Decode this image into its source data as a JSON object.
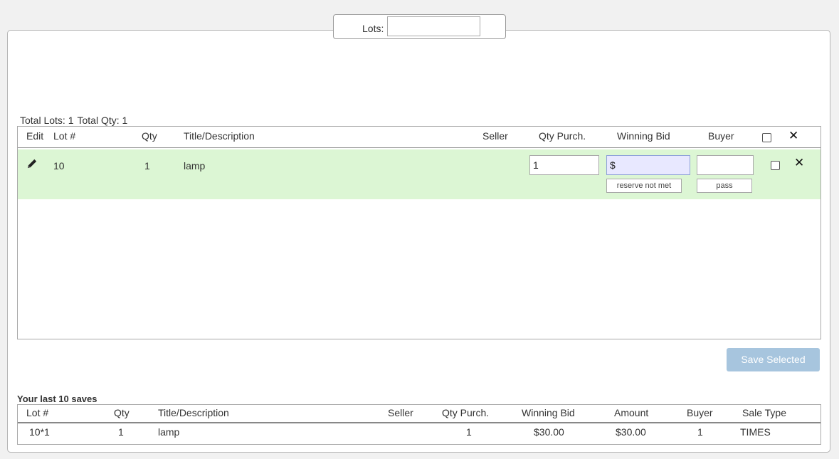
{
  "lots_filter": {
    "label": "Lots:",
    "value": ""
  },
  "totals": {
    "lots": "Total Lots: 1",
    "qty": "Total Qty: 1"
  },
  "grid": {
    "headers": {
      "edit": "Edit",
      "lot": "Lot #",
      "qty": "Qty",
      "title": "Title/Description",
      "seller": "Seller",
      "qty_purch": "Qty Purch.",
      "winning_bid": "Winning Bid",
      "buyer": "Buyer"
    },
    "row": {
      "lot": "10",
      "qty": "1",
      "title": "lamp",
      "seller": "",
      "qty_purch_value": "1",
      "winning_bid_value": "$",
      "buyer_value": "",
      "reserve_label": "reserve not met",
      "pass_label": "pass"
    }
  },
  "save_button": "Save Selected",
  "history": {
    "title": "Your last 10 saves",
    "headers": {
      "lot": "Lot #",
      "qty": "Qty",
      "title": "Title/Description",
      "seller": "Seller",
      "qty_purch": "Qty Purch.",
      "winning_bid": "Winning Bid",
      "amount": "Amount",
      "buyer": "Buyer",
      "sale_type": "Sale Type"
    },
    "rows": [
      {
        "lot": "10*1",
        "qty": "1",
        "title": "lamp",
        "seller": "",
        "qty_purch": "1",
        "winning_bid": "$30.00",
        "amount": "$30.00",
        "buyer": "1",
        "sale_type": "TIMES"
      }
    ]
  },
  "colors": {
    "row_highlight": "#dcf6d4",
    "save_button": "#a7c5de",
    "bid_field": "#e8e8ff"
  },
  "icons": {
    "edit": "pencil-icon",
    "remove": "close-icon"
  }
}
